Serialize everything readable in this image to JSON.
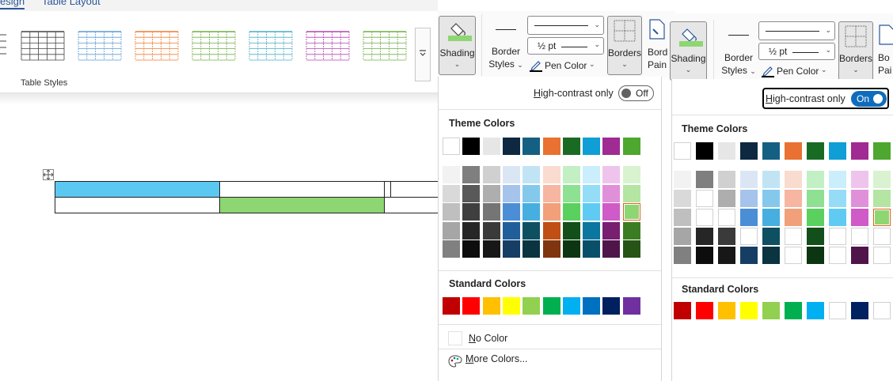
{
  "ribbon": {
    "tab_design": "esign",
    "tab_layout": "Table Layout",
    "table_styles_label": "Table Styles",
    "table_style_colors": [
      "#444444",
      "#5b9bd5",
      "#ed7d31",
      "#70ad47",
      "#4bacc6",
      "#b245b2",
      "#70ad47"
    ],
    "shading_label": "Shading",
    "border_styles_label_1": "Border",
    "border_styles_label_2": "Styles",
    "pen_weight": "½ pt",
    "pen_color_label": "Pen Color",
    "borders_label": "Borders",
    "border_painter_label_1": "Bord",
    "border_painter_label_2": "Pain",
    "border_painter_label_1b": "Bo",
    "border_painter_label_2b": "Pai"
  },
  "document": {
    "cell_colors": {
      "blue": "#5bc8f2",
      "green": "#8ed672"
    }
  },
  "dropdown_off": {
    "high_contrast_label": "High-contrast only",
    "toggle_text": "Off"
  },
  "dropdown_on": {
    "high_contrast_label": "High-contrast only",
    "toggle_text": "On"
  },
  "palette": {
    "theme_colors_title": "Theme Colors",
    "standard_colors_title": "Standard Colors",
    "no_color_label": "No Color",
    "more_colors_label": "More Colors...",
    "theme_top": [
      "#ffffff",
      "#000000",
      "#e7e6e6",
      "#0e2841",
      "#156082",
      "#e97132",
      "#196b24",
      "#0f9ed5",
      "#a02b93",
      "#4ea72e"
    ],
    "theme_shades": [
      [
        "#f2f2f2",
        "#7f7f7f",
        "#d0d0d0",
        "#dbe6f5",
        "#c1e4f5",
        "#fadbd0",
        "#c2efc3",
        "#caeefb",
        "#efc4ec",
        "#d9f2d0"
      ],
      [
        "#d9d9d9",
        "#595959",
        "#aeaeae",
        "#a6c4eb",
        "#84c9ec",
        "#f6b6a1",
        "#8ee093",
        "#95ddf7",
        "#e090d9",
        "#b4e5a2"
      ],
      [
        "#bfbfbf",
        "#3f3f3f",
        "#757575",
        "#4b8ed6",
        "#46afe0",
        "#f1a07a",
        "#5ad05e",
        "#5fcbf2",
        "#d05ac7",
        "#8ed672"
      ],
      [
        "#a6a6a6",
        "#262626",
        "#3a3a3a",
        "#215f9a",
        "#0e4f62",
        "#c04f15",
        "#124f1a",
        "#0b769f",
        "#772070",
        "#3b7d23"
      ],
      [
        "#808080",
        "#0d0d0d",
        "#171717",
        "#163e64",
        "#0a3440",
        "#7f3510",
        "#0c3512",
        "#084f6a",
        "#4f154b",
        "#275317"
      ]
    ],
    "theme_shades_hc": [
      [
        "#f2f2f2",
        "#7f7f7f",
        "#d0d0d0",
        "#dbe6f5",
        "#c1e4f5",
        "#fadbd0",
        "#c2efc3",
        "#caeefb",
        "#efc4ec",
        "#d9f2d0"
      ],
      [
        "#d9d9d9",
        "#ffffff",
        "#aeaeae",
        "#a6c4eb",
        "#84c9ec",
        "#f6b6a1",
        "#8ee093",
        "#95ddf7",
        "#e090d9",
        "#b4e5a2"
      ],
      [
        "#bfbfbf",
        "#ffffff",
        "#ffffff",
        "#4b8ed6",
        "#46afe0",
        "#f1a07a",
        "#5ad05e",
        "#5fcbf2",
        "#d05ac7",
        "#8ed672"
      ],
      [
        "#a6a6a6",
        "#262626",
        "#3a3a3a",
        "#ffffff",
        "#0e4f62",
        "#ffffff",
        "#124f1a",
        "#ffffff",
        "#ffffff",
        "#ffffff"
      ],
      [
        "#808080",
        "#0d0d0d",
        "#171717",
        "#163e64",
        "#0a3440",
        "#ffffff",
        "#0c3512",
        "#ffffff",
        "#4f154b",
        "#ffffff"
      ]
    ],
    "standard": [
      "#c00000",
      "#ff0000",
      "#ffc000",
      "#ffff00",
      "#92d050",
      "#00b050",
      "#00b0f0",
      "#0070c0",
      "#002060",
      "#7030a0"
    ],
    "standard_hc": [
      "#c00000",
      "#ff0000",
      "#ffc000",
      "#ffff00",
      "#92d050",
      "#00b050",
      "#00b0f0",
      "#ffffff",
      "#002060",
      "#ffffff"
    ],
    "selected_color": "#8ed672"
  }
}
